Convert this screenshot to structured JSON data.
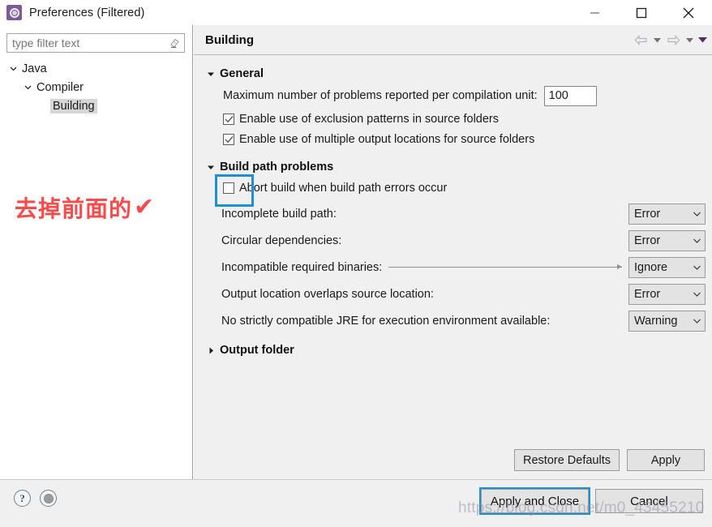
{
  "window": {
    "title": "Preferences (Filtered)",
    "icon": "preferences-gear-icon",
    "minimize_label": "Minimize",
    "maximize_label": "Maximize",
    "close_label": "Close"
  },
  "filter": {
    "placeholder": "type filter text",
    "value": "",
    "clear_icon": "eraser-icon"
  },
  "tree": {
    "items": [
      {
        "label": "Java",
        "level": 0,
        "expanded": true,
        "selected": false
      },
      {
        "label": "Compiler",
        "level": 1,
        "expanded": true,
        "selected": false
      },
      {
        "label": "Building",
        "level": 2,
        "expanded": null,
        "selected": true
      }
    ]
  },
  "annotation": {
    "text": "去掉前面的",
    "tick": "✔",
    "color": "#fb4a4a"
  },
  "content": {
    "title": "Building",
    "nav": {
      "back_label": "Back",
      "back_menu_label": "Back history",
      "forward_label": "Forward",
      "forward_menu_label": "Forward history",
      "view_menu_label": "View menu"
    },
    "sections": [
      {
        "id": "general",
        "title": "General",
        "expanded": true
      },
      {
        "id": "build-path-problems",
        "title": "Build path problems",
        "expanded": true
      },
      {
        "id": "output-folder",
        "title": "Output folder",
        "expanded": false
      }
    ],
    "general": {
      "max_problems_label": "Maximum number of problems reported per compilation unit:",
      "max_problems_value": "100",
      "exclusion_label": "Enable use of exclusion patterns in source folders",
      "exclusion_checked": true,
      "multiple_output_label": "Enable use of multiple output locations for source folders",
      "multiple_output_checked": true
    },
    "build_path": {
      "abort_label": "Abort build when build path errors occur",
      "abort_checked": false,
      "abort_focused": true,
      "rows": [
        {
          "label": "Incomplete build path:",
          "value": "Error",
          "leader": false
        },
        {
          "label": "Circular dependencies:",
          "value": "Error",
          "leader": false
        },
        {
          "label": "Incompatible required binaries:",
          "value": "Ignore",
          "leader": true
        },
        {
          "label": "Output location overlaps source location:",
          "value": "Error",
          "leader": false
        },
        {
          "label": "No strictly compatible JRE for execution environment available:",
          "value": "Warning",
          "leader": false
        }
      ],
      "severity_options": [
        "Error",
        "Warning",
        "Ignore"
      ]
    },
    "buttons": {
      "restore_defaults": "Restore Defaults",
      "apply": "Apply"
    }
  },
  "footer": {
    "help_icon": "?",
    "help_label": "Help",
    "import_export_icon": "import-export-icon",
    "apply_and_close": "Apply and Close",
    "cancel": "Cancel"
  },
  "watermark": {
    "text": "https://blog.csdn.net/m0_43455210"
  },
  "colors": {
    "accent_focus": "#1d8fd6",
    "panel_bg": "#f0f0f0",
    "tree_bg": "#ffffff",
    "annotation_red": "#fb4a4a",
    "title_icon_purple": "#7d5a9e"
  }
}
